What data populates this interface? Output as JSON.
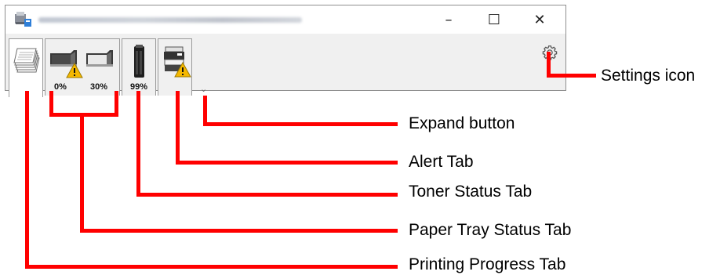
{
  "window": {
    "title_blurred": "Kyocera ECOSYS M3645iDN KX (1) / 10.168.0.22",
    "controls": {
      "minimize": "–",
      "maximize": "☐",
      "close": "✕"
    }
  },
  "tabs": {
    "paper": {
      "tray1_pct": "0%",
      "tray2_pct": "30%"
    },
    "toner": {
      "pct": "99%"
    }
  },
  "expand_glyph": "⌄",
  "annotations": [
    "Settings icon",
    "Expand button",
    "Alert Tab",
    "Toner Status Tab",
    "Paper Tray Status Tab",
    "Printing Progress Tab"
  ],
  "colors": {
    "annotation": "#ff0000",
    "warning": "#f5b800",
    "panel": "#f0f0f0"
  }
}
